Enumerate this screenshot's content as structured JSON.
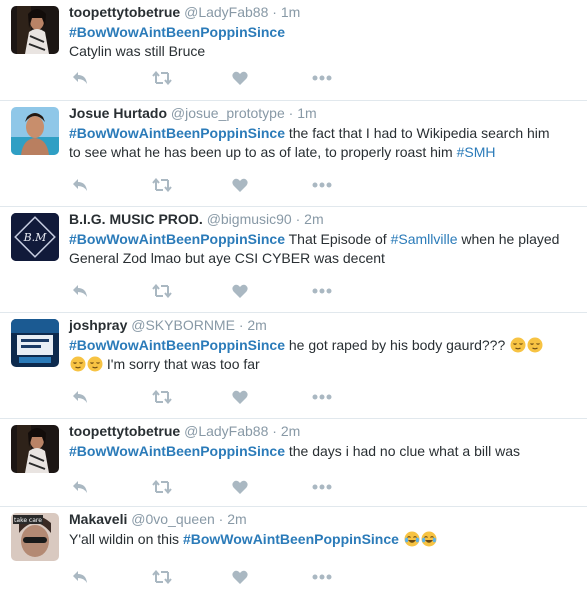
{
  "colors": {
    "link": "#2b7bb9",
    "name": "#292f33",
    "meta": "#8899a6",
    "action_icon": "#aab8c2",
    "divider": "#e1e8ed"
  },
  "action_icons": [
    "reply-icon",
    "retweet-icon",
    "like-icon",
    "more-icon"
  ],
  "tweets": [
    {
      "name": "toopettytobetrue",
      "handle": "@LadyFab88",
      "sep": "·",
      "time": "1m",
      "hashtag": "#BowWowAintBeenPoppinSince",
      "text_after": "",
      "line2": "Catylin was still Bruce"
    },
    {
      "name": "Josue Hurtado",
      "handle": "@josue_prototype",
      "sep": "·",
      "time": "1m",
      "hashtag": "#BowWowAintBeenPoppinSince",
      "text_after": " the fact that I had to Wikipedia search him",
      "line2": "to see what he has been up to as of late, to properly roast him ",
      "line2_tag": "#SMH"
    },
    {
      "name": "B.I.G. MUSIC PROD.",
      "handle": "@bigmusic90",
      "sep": "·",
      "time": "2m",
      "hashtag": "#BowWowAintBeenPoppinSince",
      "text_after": " That Episode of ",
      "inline_tag": "#Samllville",
      "text_after2": " when he played",
      "line2": "General Zod lmao but aye CSI CYBER was decent",
      "avatar_text": "B.M"
    },
    {
      "name": "joshpray",
      "handle": "@SKYBORNME",
      "sep": "·",
      "time": "2m",
      "hashtag": "#BowWowAintBeenPoppinSince",
      "text_after": " he got raped by his body gaurd??? ",
      "line2": " I'm sorry that was too far",
      "emoji": "relieved-face-emoji"
    },
    {
      "name": "toopettytobetrue",
      "handle": "@LadyFab88",
      "sep": "·",
      "time": "2m",
      "hashtag": "#BowWowAintBeenPoppinSince",
      "text_after": " the days i had no clue what a bill was"
    },
    {
      "name": "Makaveli",
      "handle": "@0vo_queen",
      "sep": "·",
      "time": "2m",
      "text_before": "Y'all wildin on this ",
      "hashtag": "#BowWowAintBeenPoppinSince",
      "emoji": "tears-of-joy-emoji",
      "avatar_text": "take care"
    }
  ]
}
